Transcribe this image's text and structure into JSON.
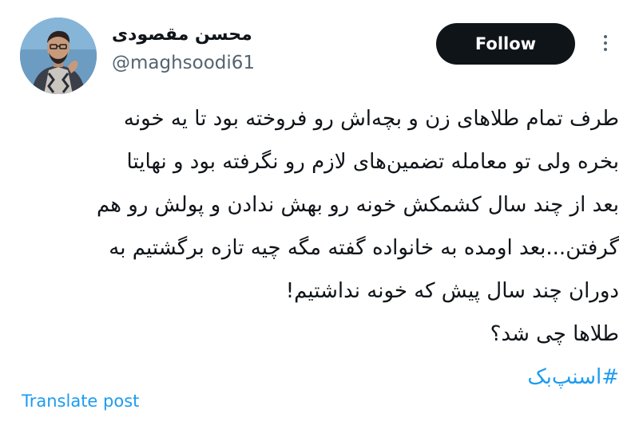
{
  "author": {
    "display_name": "محسن مقصودی",
    "handle": "@maghsoodi61",
    "avatar_icon": "profile-photo"
  },
  "actions": {
    "follow_label": "Follow",
    "more_icon": "more-vertical-icon"
  },
  "post": {
    "lines": [
      "طرف تمام طلاهای زن و بچه‌اش رو فروخته بود تا یه خونه",
      "بخره ولی تو معامله تضمین‌های لازم رو نگرفته بود و نهایتا",
      "بعد از چند سال کشمکش خونه رو بهش ندادن و پولش رو هم",
      "گرفتن...بعد اومده به خانواده گفته مگه چیه تازه برگشتیم به",
      "دوران چند سال پیش که خونه نداشتیم!",
      "طلاها چی شد؟"
    ],
    "hashtag": "#اسنپ‌بک"
  },
  "translate_label": "Translate post",
  "colors": {
    "text": "#0f1419",
    "secondary_text": "#536471",
    "link": "#1d9bf0",
    "follow_button_bg": "#0f1419",
    "follow_button_text": "#ffffff"
  }
}
